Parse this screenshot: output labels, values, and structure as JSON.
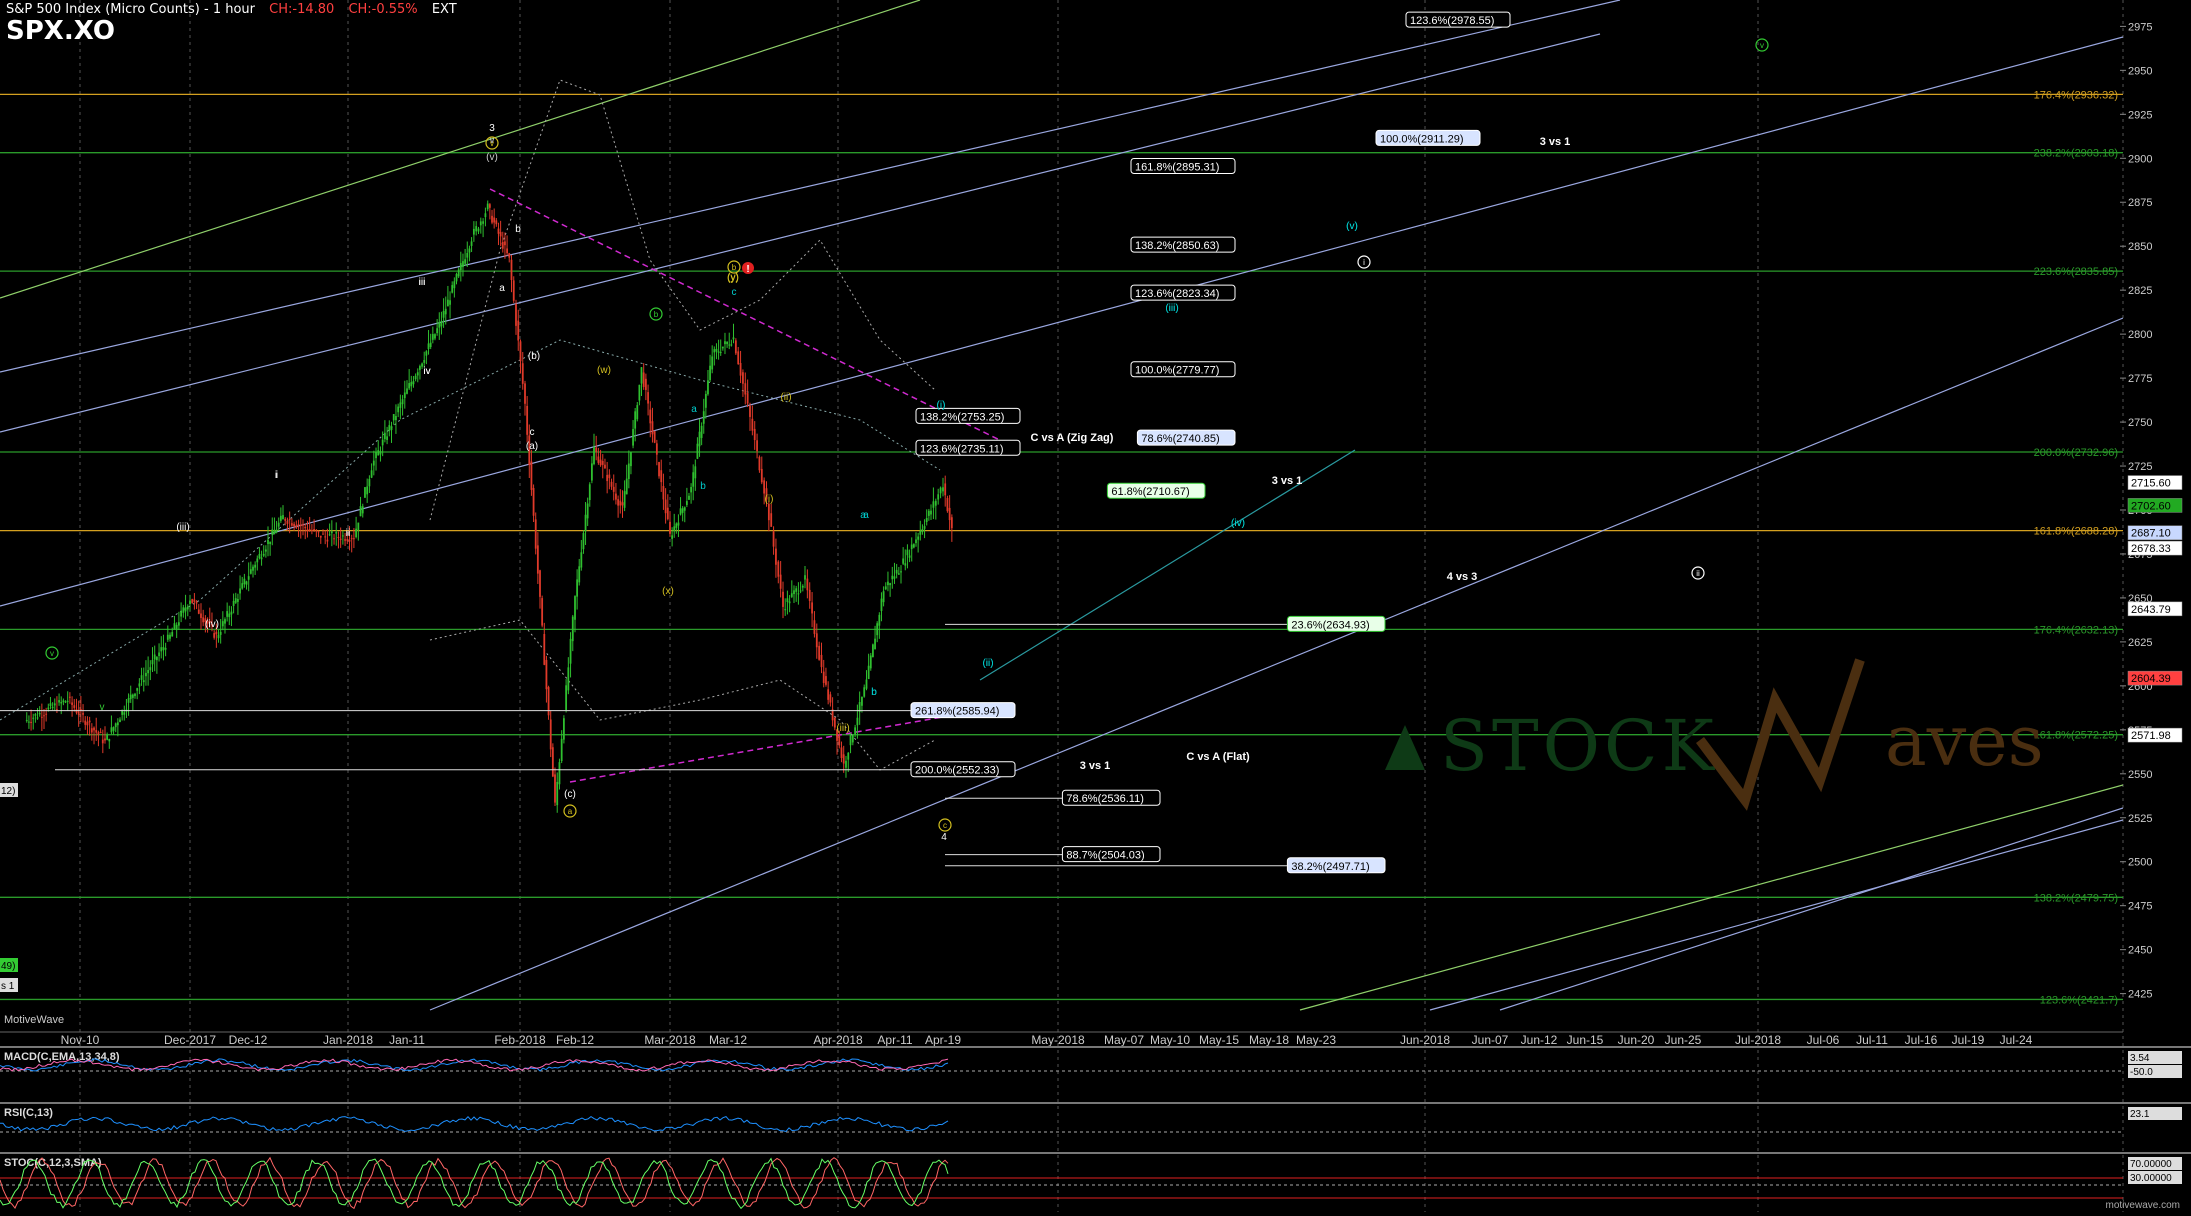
{
  "header": {
    "title": "S&P 500 Index (Micro Counts) - 1 hour",
    "change_abs": "CH:-14.80",
    "change_pct": "CH:-0.55%",
    "session": "EXT",
    "symbol": "SPX.XO"
  },
  "footer": {
    "source": "MotiveWave",
    "site": "motivewave.com"
  },
  "watermark": {
    "text_left": "STOCK",
    "text_right": "aves"
  },
  "chart_data": [
    {
      "type": "line",
      "name": "price",
      "ylim": [
        2410,
        2990
      ],
      "y_ticks": [
        2425,
        2450,
        2475,
        2500,
        2525,
        2550,
        2575,
        2600,
        2625,
        2650,
        2675,
        2700,
        2725,
        2750,
        2775,
        2800,
        2825,
        2850,
        2875,
        2900,
        2925,
        2950,
        2975
      ],
      "x_tick_labels": [
        "Nov-10",
        "Dec-2017",
        "Dec-12",
        "Jan-2018",
        "Jan-11",
        "Feb-2018",
        "Feb-12",
        "Mar-2018",
        "Mar-12",
        "Apr-2018",
        "Apr-11",
        "Apr-19",
        "May-2018",
        "May-07",
        "May-10",
        "May-15",
        "May-18",
        "May-23",
        "Jun-2018",
        "Jun-07",
        "Jun-12",
        "Jun-15",
        "Jun-20",
        "Jun-25",
        "Jul-2018",
        "Jul-06",
        "Jul-11",
        "Jul-16",
        "Jul-19",
        "Jul-24"
      ],
      "price_path": [
        [
          "Nov-01",
          2580
        ],
        [
          "Nov-08",
          2592
        ],
        [
          "Nov-15",
          2568
        ],
        [
          "Nov-21",
          2598
        ],
        [
          "Nov-28",
          2628
        ],
        [
          "Dec-01",
          2650
        ],
        [
          "Dec-06",
          2628
        ],
        [
          "Dec-13",
          2668
        ],
        [
          "Dec-19",
          2696
        ],
        [
          "Dec-27",
          2685
        ],
        [
          "Jan-02",
          2685
        ],
        [
          "Jan-05",
          2725
        ],
        [
          "Jan-11",
          2768
        ],
        [
          "Jan-17",
          2805
        ],
        [
          "Jan-23",
          2855
        ],
        [
          "Jan-26",
          2872
        ],
        [
          "Jan-30",
          2842
        ],
        [
          "Feb-02",
          2760
        ],
        [
          "Feb-05",
          2648
        ],
        [
          "Feb-08",
          2532
        ],
        [
          "Feb-12",
          2650
        ],
        [
          "Feb-16",
          2735
        ],
        [
          "Feb-22",
          2700
        ],
        [
          "Feb-26",
          2780
        ],
        [
          "Mar-01",
          2685
        ],
        [
          "Mar-05",
          2712
        ],
        [
          "Mar-09",
          2788
        ],
        [
          "Mar-13",
          2798
        ],
        [
          "Mar-16",
          2752
        ],
        [
          "Mar-19",
          2705
        ],
        [
          "Mar-22",
          2645
        ],
        [
          "Mar-26",
          2660
        ],
        [
          "Mar-29",
          2610
        ],
        [
          "Apr-02",
          2555
        ],
        [
          "Apr-06",
          2602
        ],
        [
          "Apr-09",
          2655
        ],
        [
          "Apr-12",
          2668
        ],
        [
          "Apr-17",
          2700
        ],
        [
          "Apr-19",
          2715
        ],
        [
          "Apr-20",
          2688
        ]
      ],
      "fib_levels_right": [
        {
          "label": "176.4%(2936.32)",
          "value": 2936.32,
          "color": "#d4a020"
        },
        {
          "label": "238.2%(2903.18)",
          "value": 2903.18,
          "color": "#2a9a2a"
        },
        {
          "label": "223.6%(2835.85)",
          "value": 2835.85,
          "color": "#2a9a2a"
        },
        {
          "label": "200.0%(2732.96)",
          "value": 2732.96,
          "color": "#2a9a2a"
        },
        {
          "label": "161.8%(2688.28)",
          "value": 2688.28,
          "color": "#d4a020"
        },
        {
          "label": "176.4%(2632.13)",
          "value": 2632.13,
          "color": "#2a9a2a"
        },
        {
          "label": "161.8%(2572.25)",
          "value": 2572.25,
          "color": "#2a9a2a"
        },
        {
          "label": "138.2%(2479.75)",
          "value": 2479.75,
          "color": "#2a9a2a"
        },
        {
          "label": "123.6%(2421.7)",
          "value": 2421.7,
          "color": "#2a9a2a"
        }
      ],
      "fib_boxes": [
        {
          "label": "123.6%(2978.55)",
          "value": 2978.55,
          "style": "white"
        },
        {
          "label": "100.0%(2911.29)",
          "value": 2911.29,
          "style": "blue"
        },
        {
          "label": "161.8%(2895.31)",
          "value": 2895.31,
          "style": "white"
        },
        {
          "label": "138.2%(2850.63)",
          "value": 2850.63,
          "style": "white"
        },
        {
          "label": "123.6%(2823.34)",
          "value": 2823.34,
          "style": "white"
        },
        {
          "label": "100.0%(2779.77)",
          "value": 2779.77,
          "style": "white"
        },
        {
          "label": "138.2%(2753.25)",
          "value": 2753.25,
          "style": "white"
        },
        {
          "label": "78.6%(2740.85)",
          "value": 2740.85,
          "style": "blue"
        },
        {
          "label": "123.6%(2735.11)",
          "value": 2735.11,
          "style": "white"
        },
        {
          "label": "61.8%(2710.67)",
          "value": 2710.67,
          "style": "green"
        },
        {
          "label": "23.6%(2634.93)",
          "value": 2634.93,
          "style": "green"
        },
        {
          "label": "261.8%(2585.94)",
          "value": 2585.94,
          "style": "blue"
        },
        {
          "label": "200.0%(2552.33)",
          "value": 2552.33,
          "style": "white"
        },
        {
          "label": "78.6%(2536.11)",
          "value": 2536.11,
          "style": "white"
        },
        {
          "label": "88.7%(2504.03)",
          "value": 2504.03,
          "style": "white"
        },
        {
          "label": "38.2%(2497.71)",
          "value": 2497.71,
          "style": "blue"
        }
      ],
      "annotations": [
        "3 vs 1",
        "C vs A (Zig Zag)",
        "3 vs 1",
        "4 vs 3",
        "C vs A (Flat)",
        "3 vs 1"
      ],
      "wave_labels": [
        "3",
        "v",
        "(v)",
        "a",
        "b",
        "iii",
        "iv",
        "i",
        "ii",
        "(iii)",
        "(iv)",
        "c",
        "(b)",
        "(a)",
        "(c)",
        "a",
        "(w)",
        "(x)",
        "(y)",
        "b",
        "a",
        "b",
        "c",
        "(y)",
        "(i)",
        "(ii)",
        "(i)",
        "(iii)",
        "(ii)",
        "a",
        "b",
        "(iii)",
        "(iv)",
        "(v)",
        "4",
        "(i)",
        "(ii)",
        "(iii)",
        "(iv)",
        "(v)",
        "i",
        "ii",
        "iii",
        "iv",
        "v"
      ],
      "right_axis_badges": [
        {
          "label": "2715.60",
          "value": 2715.6,
          "color": "#ffffff"
        },
        {
          "label": "2702.60",
          "value": 2702.6,
          "color": "#22aa22"
        },
        {
          "label": "2687.10",
          "value": 2687.1,
          "color": "#c8d8ff"
        },
        {
          "label": "2678.33",
          "value": 2678.33,
          "color": "#ffffff"
        },
        {
          "label": "2643.79",
          "value": 2643.79,
          "color": "#ffffff"
        },
        {
          "label": "2604.39",
          "value": 2604.39,
          "color": "#ff4040"
        },
        {
          "label": "2571.98",
          "value": 2571.98,
          "color": "#ffffff"
        }
      ],
      "left_edge_badges": [
        "12)",
        "49)",
        "s 1"
      ],
      "grid": true
    },
    {
      "type": "line",
      "name": "MACD",
      "title": "MACD(C,EMA,13,34,8)",
      "right_badges": [
        "3.54",
        "-50.0"
      ],
      "series": [
        {
          "name": "MACD",
          "color": "#1e90ff"
        },
        {
          "name": "Signal",
          "color": "#ff69b4"
        }
      ]
    },
    {
      "type": "line",
      "name": "RSI",
      "title": "RSI(C,13)",
      "right_badges": [
        "23.1"
      ],
      "series": [
        {
          "name": "RSI",
          "color": "#1e90ff"
        }
      ]
    },
    {
      "type": "line",
      "name": "STOC",
      "title": "STOC(C,12,3,SMA)",
      "right_badges": [
        "70.00000",
        "30.00000"
      ],
      "series": [
        {
          "name": "%K",
          "color": "#ff6666"
        },
        {
          "name": "%D",
          "color": "#66ff66"
        }
      ]
    }
  ]
}
